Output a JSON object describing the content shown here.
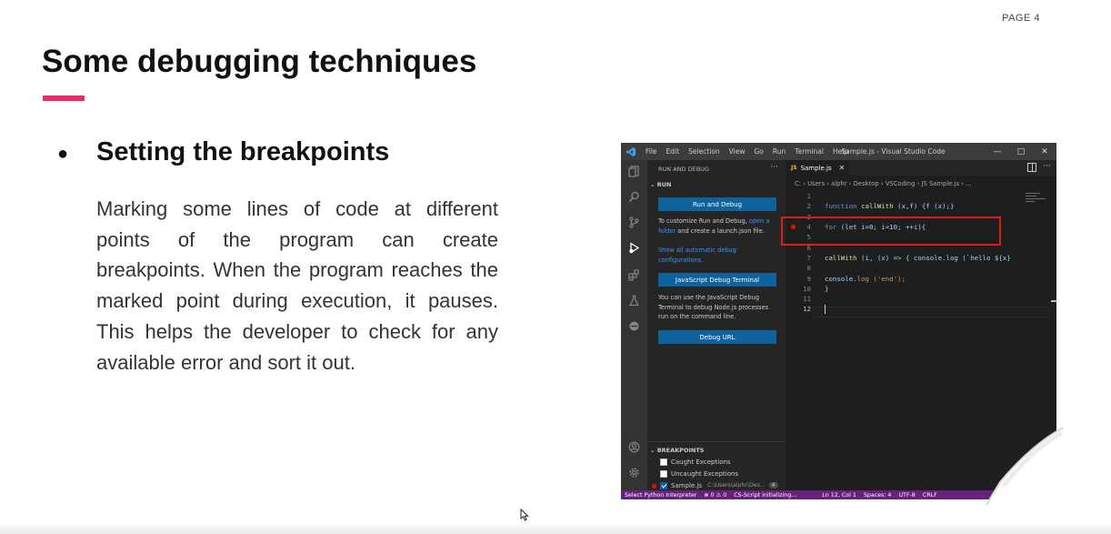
{
  "slide": {
    "page_label": "PAGE 4",
    "title": "Some debugging techniques",
    "accent_color": "#f0296f",
    "bullet_title": "Setting the breakpoints",
    "body": "Marking some lines of code at different points of the program can create breakpoints. When the program reaches the marked point during execution, it pauses. This helps the developer to check for any available error and sort it out."
  },
  "vscode": {
    "menu": [
      "File",
      "Edit",
      "Selection",
      "View",
      "Go",
      "Run",
      "Terminal",
      "Help"
    ],
    "window_title": "Sample.js - Visual Studio Code",
    "window_controls": [
      "minimize-icon",
      "maximize-icon",
      "close-icon"
    ],
    "activity_icons": [
      "explorer-icon",
      "search-icon",
      "source-control-icon",
      "run-debug-icon",
      "extensions-icon",
      "testing-icon",
      "remote-icon",
      "account-icon",
      "settings-gear-icon"
    ],
    "sidebar": {
      "header": "RUN AND DEBUG",
      "more": "···",
      "section": "RUN",
      "run_debug_button": "Run and Debug",
      "customize_prefix": "To customize Run and Debug,",
      "customize_link": "open a folder",
      "customize_suffix": "and create a launch.json file.",
      "show_configs_link": "Show all automatic debug configurations.",
      "terminal_button": "JavaScript Debug Terminal",
      "terminal_desc": "You can use the JavaScript Debug Terminal to debug Node.js processes run on the command line.",
      "debug_url_button": "Debug URL",
      "breakpoints": {
        "header": "BREAKPOINTS",
        "items": [
          {
            "label": "Caught Exceptions",
            "checked": false
          },
          {
            "label": "Uncaught Exceptions",
            "checked": false
          },
          {
            "label": "Sample.js",
            "checked": true,
            "path": "C:\\Users\\alphr\\Des...",
            "count": "4"
          }
        ]
      }
    },
    "editor": {
      "tab_badge": "JS",
      "tab_name": "Sample.js",
      "tab_close": "✕",
      "breadcrumb": "C: › Users › alphr › Desktop › VSCoding › JS Sample.js › ...",
      "line_numbers": [
        "1",
        "2",
        "3",
        "4",
        "5",
        "6",
        "7",
        "8",
        "9",
        "10",
        "11",
        "12"
      ],
      "lines": {
        "l2": {
          "kw": "function",
          "fn": "callWith",
          "rest": " (x,f) {f (x);}"
        },
        "l4": {
          "kw": "for",
          "rest": " (let i=0; i<10; ++i){"
        },
        "l7": {
          "fn": "callWith",
          "rest": " (i, (x) => { console.log (`hello ${x}"
        },
        "l9": {
          "var": "console",
          "rest": ".log ('end');"
        },
        "l10": {
          "rest": "}"
        }
      }
    },
    "status": {
      "interpreter": "Select Python Interpreter",
      "problems": "⊗ 0 ⚠ 0",
      "script": "CS-Script initializing...",
      "position": "Ln 12, Col 1",
      "spaces": "Spaces: 4",
      "encoding": "UTF-8",
      "eol": "CRLF"
    },
    "colors": {
      "statusbar": "#68217a",
      "button": "#0e639c",
      "breakpoint": "#e51400",
      "highlight_box": "#d91e1e"
    }
  }
}
